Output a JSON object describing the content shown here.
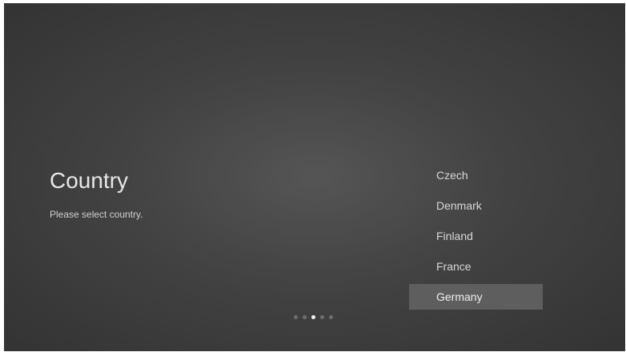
{
  "page": {
    "title": "Country",
    "subtitle": "Please select country."
  },
  "countries": {
    "items": [
      {
        "label": "Czech"
      },
      {
        "label": "Denmark"
      },
      {
        "label": "Finland"
      },
      {
        "label": "France"
      },
      {
        "label": "Germany"
      }
    ],
    "selected": "Germany"
  },
  "pager": {
    "total": 5,
    "current": 3
  },
  "colors": {
    "background": "#444444",
    "selected_row": "#5e5e5e",
    "text": "#d8d8d8",
    "dot_inactive": "#6f6f6f",
    "dot_active": "#f2f2f2"
  }
}
